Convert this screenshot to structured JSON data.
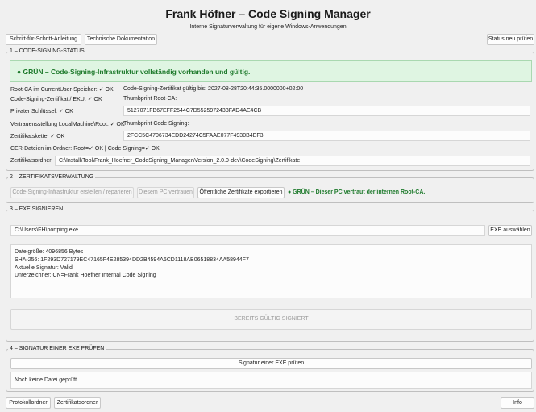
{
  "header": {
    "title": "Frank Höfner – Code Signing Manager",
    "subtitle": "Interne Signaturverwaltung für eigene Windows-Anwendungen"
  },
  "toolbar": {
    "guide_label": "Schritt-für-Schritt-Anleitung",
    "docs_label": "Technische Dokumentation",
    "recheck_label": "Status neu prüfen"
  },
  "status_section": {
    "title": "1 – CODE-SIGNING-STATUS",
    "banner": "● GRÜN – Code-Signing-Infrastruktur vollständig vorhanden und gültig.",
    "root_ca": "Root-CA im CurrentUser-Speicher: ✓ OK",
    "cert_valid_until": "Code-Signing-Zertifikat gültig bis: 2027-08-28T20:44:35.0000000+02:00",
    "cert_eku": "Code-Signing-Zertifikat / EKU: ✓ OK",
    "thumbprint_root_label": "Thumbprint Root-CA:",
    "private_key": "Privater Schlüssel: ✓ OK",
    "thumbprint_root_value": "5127071FB67EFF2544C7D5525972433FAD4AE4CB",
    "trust_local_machine": "Vertrauensstellung LocalMachine\\Root: ✓ OK",
    "thumbprint_cs_label": "Thumbprint Code Signing:",
    "cert_chain": "Zertifikatskette: ✓ OK",
    "thumbprint_cs_value": "2FCC5C4706734EDD24274C5FAAE077F4930B4EF3",
    "cer_files": "CER-Dateien im Ordner: Root=✓ OK | Code Signing=✓ OK",
    "cert_folder_label": "Zertifikatsordner:",
    "cert_folder_value": "C:\\Install\\Tool\\Frank_Hoefner_CodeSigning_Manager\\Version_2.0.0-dev\\CodeSigning\\Zertifikate"
  },
  "cert_mgmt_section": {
    "title": "2 – ZERTIFIKATSVERWALTUNG",
    "create_label": "Code-Signing-Infrastruktur erstellen / reparieren",
    "trust_label": "Diesem PC vertrauen",
    "export_label": "Öffentliche Zertifikate exportieren",
    "status_text": "● GRÜN – Dieser PC vertraut der internen Root-CA."
  },
  "sign_section": {
    "title": "3 – EXE SIGNIEREN",
    "exe_path": "C:\\Users\\FH\\portping.exe",
    "select_label": "EXE auswählen",
    "info_lines": [
      "Dateigröße: 4096856 Bytes",
      "SHA-256: 1F293D727179EC47165F4E285394DD2B4594A6CD1118AB06518834AA58944F7",
      "Aktuelle Signatur: Valid",
      "Unterzeichner: CN=Frank Hoefner Internal Code Signing"
    ],
    "signed_label": "BEREITS GÜLTIG SIGNIERT"
  },
  "verify_section": {
    "title": "4 – SIGNATUR EINER EXE PRÜFEN",
    "verify_label": "Signatur einer EXE prüfen",
    "result_text": "Noch keine Datei geprüft."
  },
  "footer": {
    "log_folder_label": "Protokollordner",
    "cert_folder_label": "Zertifikatsordner",
    "info_label": "Info"
  },
  "colors": {
    "background": "#f0f0f0",
    "status_green": "#1e7a2c",
    "banner_bg": "#dff5e2"
  }
}
